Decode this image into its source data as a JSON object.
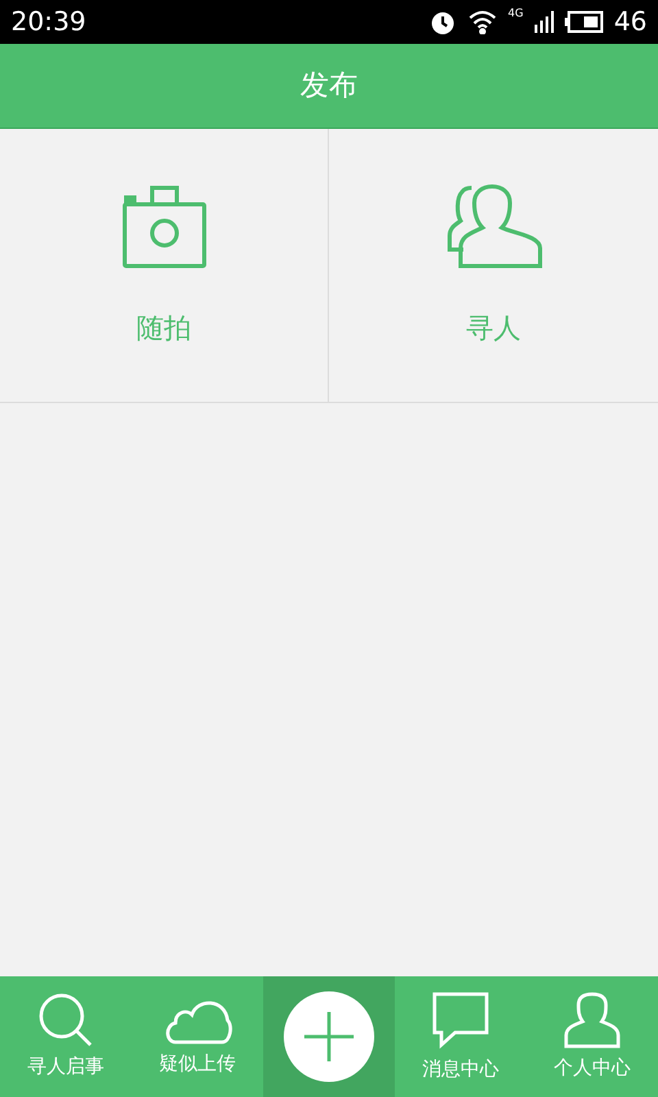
{
  "status_bar": {
    "time": "20:39",
    "network": "4G",
    "battery": "46"
  },
  "header": {
    "title": "发布"
  },
  "options": [
    {
      "kind": "camera",
      "label": "随拍"
    },
    {
      "kind": "people",
      "label": "寻人"
    }
  ],
  "nav": [
    {
      "kind": "search",
      "label": "寻人启事",
      "selected": false
    },
    {
      "kind": "cloud",
      "label": "疑似上传",
      "selected": false
    },
    {
      "kind": "add",
      "selected": true
    },
    {
      "kind": "chat",
      "label": "消息中心",
      "selected": false
    },
    {
      "kind": "person",
      "label": "个人中心",
      "selected": false
    }
  ]
}
